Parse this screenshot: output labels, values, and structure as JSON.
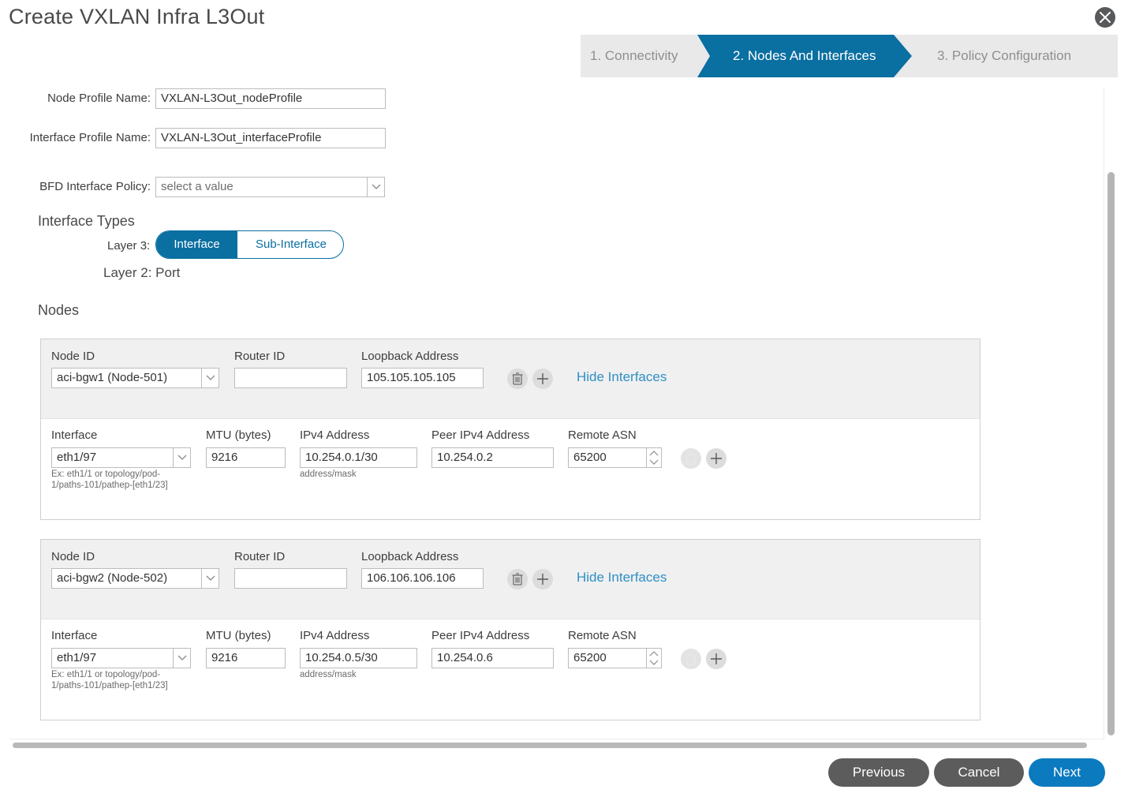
{
  "dialog": {
    "title": "Create VXLAN Infra L3Out"
  },
  "wizard": {
    "steps": [
      {
        "label": "1. Connectivity",
        "state": "done"
      },
      {
        "label": "2. Nodes And Interfaces",
        "state": "active"
      },
      {
        "label": "3. Policy Configuration",
        "state": "pending"
      }
    ],
    "active_color": "#0a6fa1"
  },
  "form": {
    "node_profile_label": "Node Profile Name:",
    "node_profile_value": "VXLAN-L3Out_nodeProfile",
    "interface_profile_label": "Interface Profile Name:",
    "interface_profile_value": "VXLAN-L3Out_interfaceProfile",
    "bfd_label": "BFD Interface Policy:",
    "bfd_placeholder": "select a value",
    "interface_types_heading": "Interface Types",
    "layer3_label": "Layer 3:",
    "layer3_options": [
      "Interface",
      "Sub-Interface"
    ],
    "layer3_selected": "Interface",
    "layer2_text": "Layer 2: Port",
    "nodes_heading": "Nodes"
  },
  "node_columns": {
    "node_id": "Node ID",
    "router_id": "Router ID",
    "loopback": "Loopback Address",
    "hide_interfaces": "Hide Interfaces"
  },
  "interface_columns": {
    "interface": "Interface",
    "mtu": "MTU (bytes)",
    "ipv4": "IPv4 Address",
    "peer_ipv4": "Peer IPv4 Address",
    "remote_asn": "Remote ASN",
    "interface_hint_1": "Ex: eth1/1 or topology/pod-",
    "interface_hint_2": "1/paths-101/pathep-[eth1/23]",
    "ipv4_hint": "address/mask"
  },
  "nodes": [
    {
      "node_id": "aci-bgw1 (Node-501)",
      "router_id": "",
      "loopback": "105.105.105.105",
      "interface": {
        "interface": "eth1/97",
        "mtu": "9216",
        "ipv4": "10.254.0.1/30",
        "peer_ipv4": "10.254.0.2",
        "remote_asn": "65200"
      }
    },
    {
      "node_id": "aci-bgw2 (Node-502)",
      "router_id": "",
      "loopback": "106.106.106.106",
      "interface": {
        "interface": "eth1/97",
        "mtu": "9216",
        "ipv4": "10.254.0.5/30",
        "peer_ipv4": "10.254.0.6",
        "remote_asn": "65200"
      }
    }
  ],
  "footer": {
    "previous": "Previous",
    "cancel": "Cancel",
    "next": "Next"
  }
}
